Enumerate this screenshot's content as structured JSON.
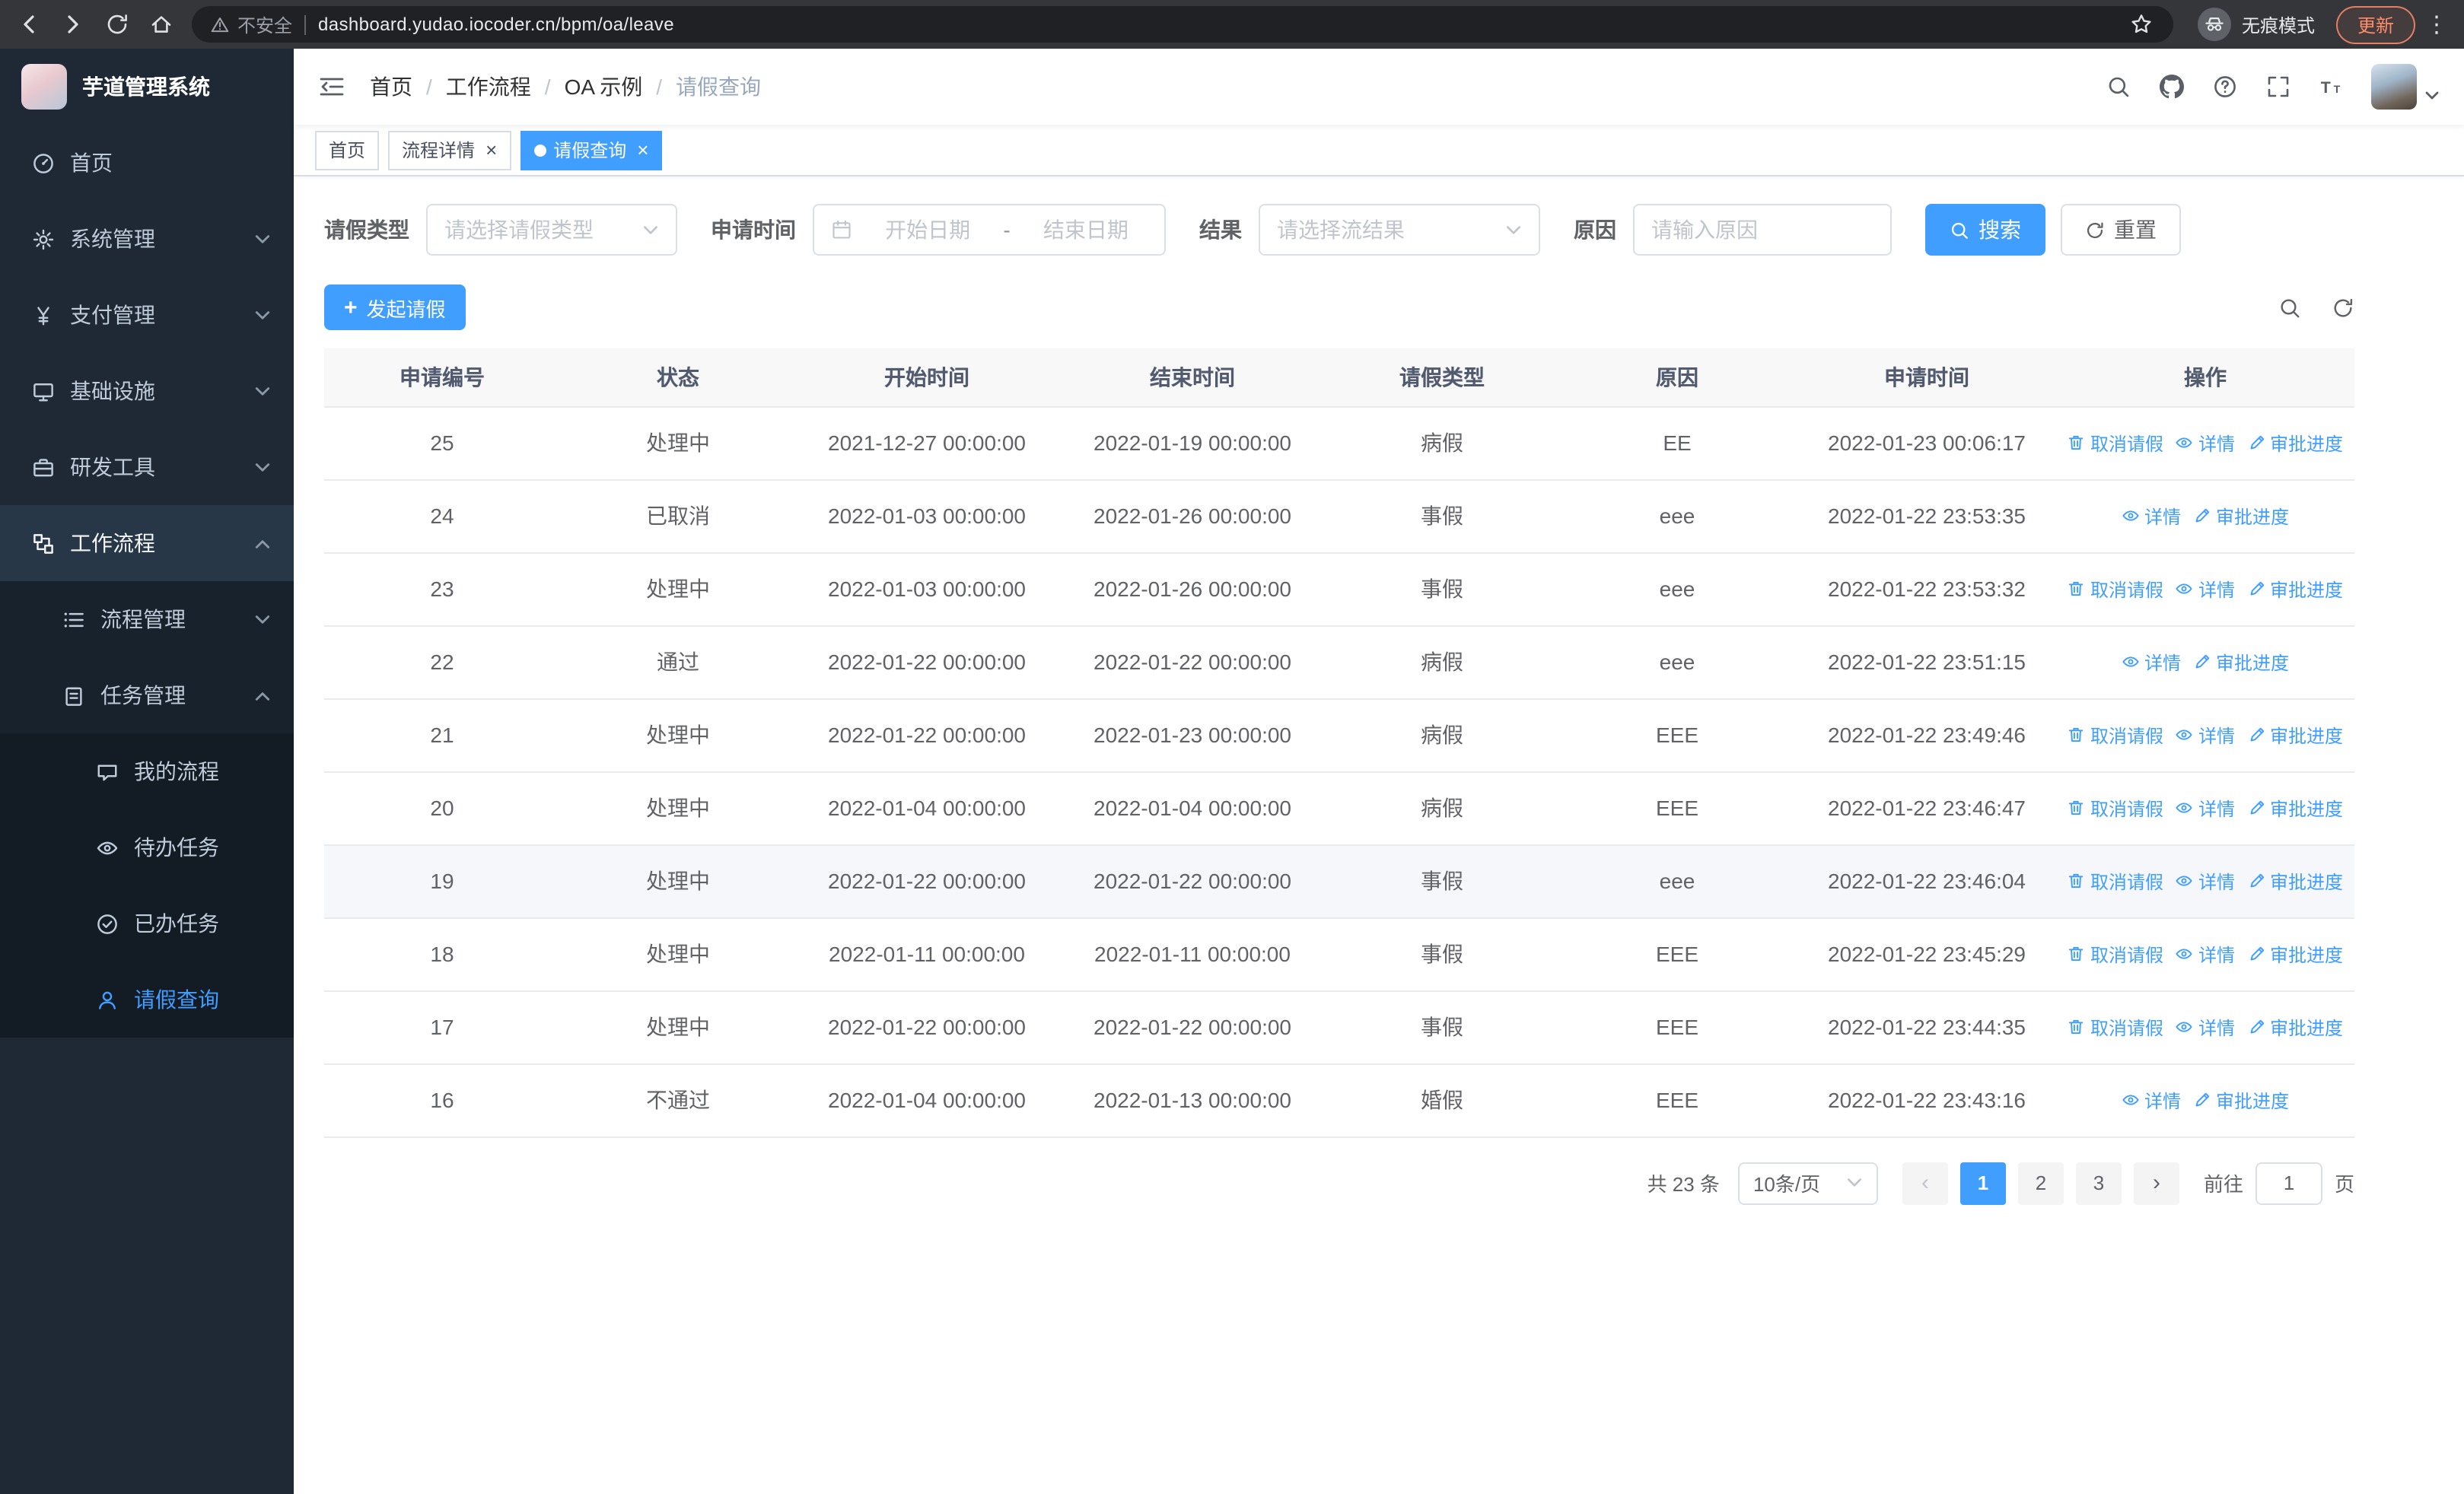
{
  "colors": {
    "primary": "#409eff",
    "sidebar_bg": "#1f2936"
  },
  "browser": {
    "nav_icons": [
      "back-icon",
      "forward-icon",
      "reload-icon",
      "home-icon"
    ],
    "security_warning": "不安全",
    "url": "dashboard.yudao.iocoder.cn/bpm/oa/leave",
    "incognito_label": "无痕模式",
    "update_label": "更新"
  },
  "sidebar": {
    "logo_title": "芋道管理系统",
    "menu": [
      {
        "key": "home",
        "label": "首页",
        "icon": "dashboard-icon",
        "level": 1
      },
      {
        "key": "system",
        "label": "系统管理",
        "icon": "gear-icon",
        "level": 1,
        "chevron": "down"
      },
      {
        "key": "payment",
        "label": "支付管理",
        "icon": "yen-icon",
        "level": 1,
        "chevron": "down"
      },
      {
        "key": "infrastructure",
        "label": "基础设施",
        "icon": "monitor-icon",
        "level": 1,
        "chevron": "down"
      },
      {
        "key": "devtools",
        "label": "研发工具",
        "icon": "toolbox-icon",
        "level": 1,
        "chevron": "down"
      },
      {
        "key": "workflow",
        "label": "工作流程",
        "icon": "workflow-icon",
        "level": 1,
        "chevron": "up",
        "highlight": true
      },
      {
        "key": "process-management",
        "label": "流程管理",
        "icon": "list-icon",
        "level": 2,
        "chevron": "down"
      },
      {
        "key": "task-management",
        "label": "任务管理",
        "icon": "clipboard-icon",
        "level": 2,
        "chevron": "up"
      },
      {
        "key": "my-process",
        "label": "我的流程",
        "icon": "chat-icon",
        "level": 3
      },
      {
        "key": "todo-tasks",
        "label": "待办任务",
        "icon": "eye-icon",
        "level": 3
      },
      {
        "key": "done-tasks",
        "label": "已办任务",
        "icon": "check-circle-icon",
        "level": 3
      },
      {
        "key": "leave-query",
        "label": "请假查询",
        "icon": "user-icon",
        "level": 3,
        "active": true
      }
    ]
  },
  "header": {
    "breadcrumb": [
      "首页",
      "工作流程",
      "OA 示例",
      "请假查询"
    ],
    "icons": [
      "search-icon",
      "github-icon",
      "docs-icon",
      "fullscreen-icon",
      "font-size-icon"
    ]
  },
  "tabs": [
    {
      "key": "home",
      "label": "首页",
      "closable": false,
      "active": false
    },
    {
      "key": "process-detail",
      "label": "流程详情",
      "closable": true,
      "active": false
    },
    {
      "key": "leave-query",
      "label": "请假查询",
      "closable": true,
      "active": true
    }
  ],
  "filters": {
    "leave_type_label": "请假类型",
    "leave_type_placeholder": "请选择请假类型",
    "apply_time_label": "申请时间",
    "start_date_placeholder": "开始日期",
    "range_separator": "-",
    "end_date_placeholder": "结束日期",
    "result_label": "结果",
    "result_placeholder": "请选择流结果",
    "reason_label": "原因",
    "reason_placeholder": "请输入原因",
    "search_button": "搜索",
    "reset_button": "重置"
  },
  "toolbar": {
    "create_button": "发起请假",
    "icons": [
      "search-icon",
      "refresh-icon"
    ]
  },
  "table": {
    "columns": [
      "申请编号",
      "状态",
      "开始时间",
      "结束时间",
      "请假类型",
      "原因",
      "申请时间",
      "操作"
    ],
    "action_labels": {
      "cancel": "取消请假",
      "detail": "详情",
      "progress": "审批进度"
    },
    "rows": [
      {
        "id": "25",
        "status": "处理中",
        "start": "2021-12-27 00:00:00",
        "end": "2022-01-19 00:00:00",
        "type": "病假",
        "reason": "EE",
        "applyTime": "2022-01-23 00:06:17",
        "cancellable": true
      },
      {
        "id": "24",
        "status": "已取消",
        "start": "2022-01-03 00:00:00",
        "end": "2022-01-26 00:00:00",
        "type": "事假",
        "reason": "eee",
        "applyTime": "2022-01-22 23:53:35",
        "cancellable": false
      },
      {
        "id": "23",
        "status": "处理中",
        "start": "2022-01-03 00:00:00",
        "end": "2022-01-26 00:00:00",
        "type": "事假",
        "reason": "eee",
        "applyTime": "2022-01-22 23:53:32",
        "cancellable": true
      },
      {
        "id": "22",
        "status": "通过",
        "start": "2022-01-22 00:00:00",
        "end": "2022-01-22 00:00:00",
        "type": "病假",
        "reason": "eee",
        "applyTime": "2022-01-22 23:51:15",
        "cancellable": false
      },
      {
        "id": "21",
        "status": "处理中",
        "start": "2022-01-22 00:00:00",
        "end": "2022-01-23 00:00:00",
        "type": "病假",
        "reason": "EEE",
        "applyTime": "2022-01-22 23:49:46",
        "cancellable": true
      },
      {
        "id": "20",
        "status": "处理中",
        "start": "2022-01-04 00:00:00",
        "end": "2022-01-04 00:00:00",
        "type": "病假",
        "reason": "EEE",
        "applyTime": "2022-01-22 23:46:47",
        "cancellable": true
      },
      {
        "id": "19",
        "status": "处理中",
        "start": "2022-01-22 00:00:00",
        "end": "2022-01-22 00:00:00",
        "type": "事假",
        "reason": "eee",
        "applyTime": "2022-01-22 23:46:04",
        "cancellable": true,
        "hover": true
      },
      {
        "id": "18",
        "status": "处理中",
        "start": "2022-01-11 00:00:00",
        "end": "2022-01-11 00:00:00",
        "type": "事假",
        "reason": "EEE",
        "applyTime": "2022-01-22 23:45:29",
        "cancellable": true
      },
      {
        "id": "17",
        "status": "处理中",
        "start": "2022-01-22 00:00:00",
        "end": "2022-01-22 00:00:00",
        "type": "事假",
        "reason": "EEE",
        "applyTime": "2022-01-22 23:44:35",
        "cancellable": true
      },
      {
        "id": "16",
        "status": "不通过",
        "start": "2022-01-04 00:00:00",
        "end": "2022-01-13 00:00:00",
        "type": "婚假",
        "reason": "EEE",
        "applyTime": "2022-01-22 23:43:16",
        "cancellable": false
      }
    ]
  },
  "pagination": {
    "total_text": "共 23 条",
    "page_size": "10条/页",
    "pages": [
      "1",
      "2",
      "3"
    ],
    "current_page": "1",
    "goto_label": "前往",
    "goto_value": "1",
    "page_label": "页"
  }
}
